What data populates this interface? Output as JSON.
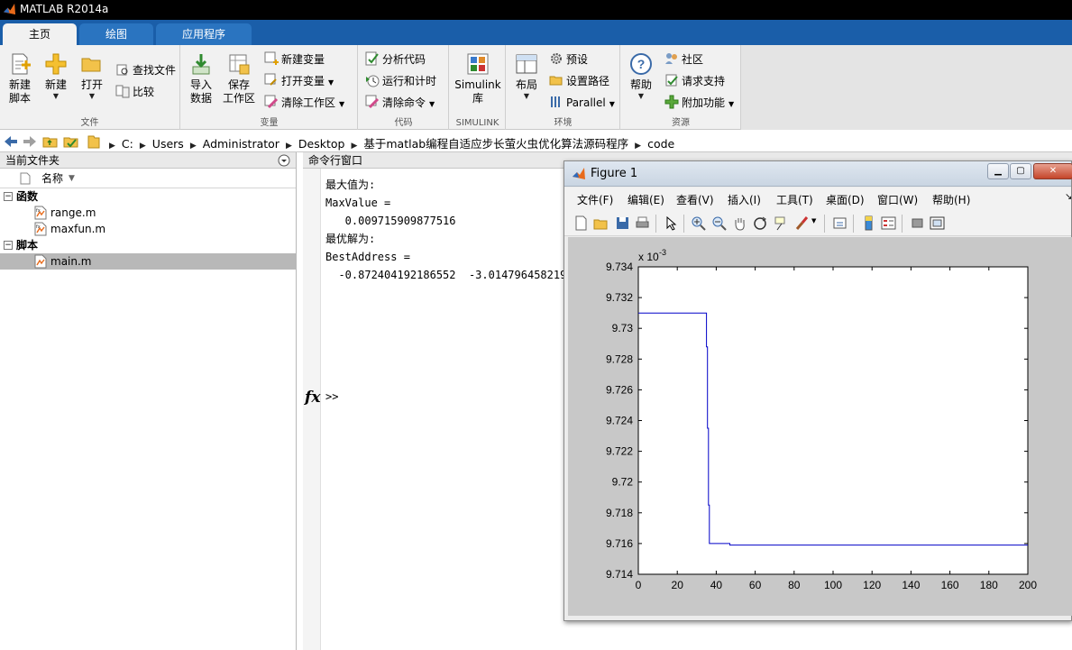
{
  "window": {
    "title": "MATLAB R2014a"
  },
  "tabs": [
    {
      "label": "主页",
      "active": true
    },
    {
      "label": "绘图",
      "active": false
    },
    {
      "label": "应用程序",
      "active": false
    }
  ],
  "ribbon": {
    "file": {
      "label": "文件",
      "new_script": [
        "新建",
        "脚本"
      ],
      "new": "新建",
      "open": "打开",
      "find_files": "查找文件",
      "compare": "比较"
    },
    "variable": {
      "label": "变量",
      "import": [
        "导入",
        "数据"
      ],
      "save": [
        "保存",
        "工作区"
      ],
      "new_variable": "新建变量",
      "open_variable": "打开变量",
      "clear_workspace": "清除工作区"
    },
    "code": {
      "label": "代码",
      "analyze": "分析代码",
      "run_time": "运行和计时",
      "clear_commands": "清除命令"
    },
    "simulink": {
      "label": "SIMULINK",
      "button": [
        "Simulink",
        "库"
      ]
    },
    "environment": {
      "label": "环境",
      "layout": "布局",
      "preferences": "预设",
      "set_path": "设置路径",
      "parallel": "Parallel"
    },
    "resources": {
      "label": "资源",
      "help": "帮助",
      "community": "社区",
      "support": "请求支持",
      "addons": "附加功能"
    }
  },
  "address": {
    "path": [
      "C:",
      "Users",
      "Administrator",
      "Desktop",
      "基于matlab编程自适应步长萤火虫优化算法源码程序",
      "code"
    ]
  },
  "file_browser": {
    "title": "当前文件夹",
    "column_name": "名称",
    "sections": [
      {
        "label": "函数",
        "files": [
          {
            "name": "range.m"
          },
          {
            "name": "maxfun.m"
          }
        ]
      },
      {
        "label": "脚本",
        "files": [
          {
            "name": "main.m",
            "selected": true
          }
        ]
      }
    ]
  },
  "command_window": {
    "title": "命令行窗口",
    "lines": [
      "最大值为:",
      "",
      "MaxValue =",
      "",
      "   0.009715909877516",
      "",
      "最优解为:",
      "",
      "BestAddress =",
      "",
      "  -0.872404192186552  -3.014796458219"
    ],
    "fx": "fx",
    "prompt": ">>"
  },
  "figure": {
    "title": "Figure 1",
    "menu": [
      "文件(F)",
      "编辑(E)",
      "查看(V)",
      "插入(I)",
      "工具(T)",
      "桌面(D)",
      "窗口(W)",
      "帮助(H)"
    ]
  },
  "chart_data": {
    "type": "line",
    "title": "",
    "xlabel": "",
    "ylabel": "",
    "exponent_label": "x 10",
    "exponent_power": "-3",
    "xlim": [
      0,
      200
    ],
    "ylim": [
      9.714,
      9.734
    ],
    "xticks": [
      "0",
      "20",
      "40",
      "60",
      "80",
      "100",
      "120",
      "140",
      "160",
      "180",
      "200"
    ],
    "yticks": [
      "9.714",
      "9.716",
      "9.718",
      "9.72",
      "9.722",
      "9.724",
      "9.726",
      "9.728",
      "9.73",
      "9.732",
      "9.734"
    ],
    "grid": false,
    "color": "#0000c8",
    "series": [
      {
        "x": [
          0,
          35,
          35,
          35.5,
          35.5,
          36,
          36,
          36.5,
          36.5,
          47,
          47,
          200
        ],
        "y": [
          9.731,
          9.731,
          9.7288,
          9.7288,
          9.7235,
          9.7235,
          9.7185,
          9.7185,
          9.716,
          9.716,
          9.7159,
          9.7159
        ]
      }
    ]
  }
}
